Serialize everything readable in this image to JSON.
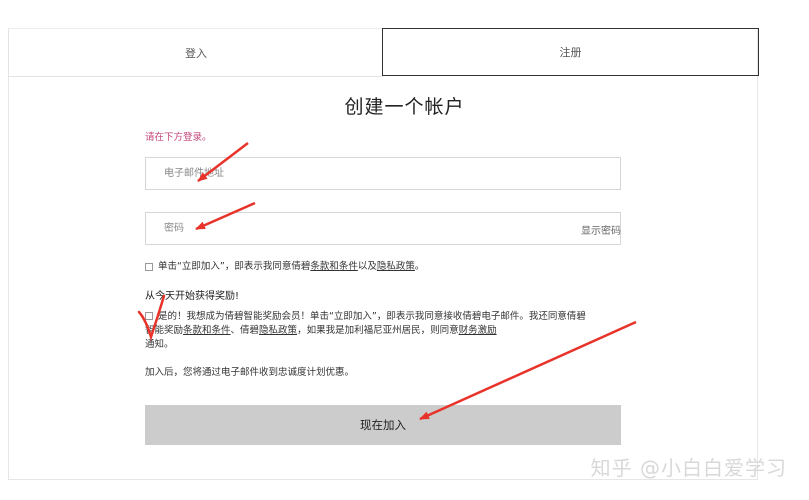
{
  "tabs": {
    "login": "登入",
    "register": "注册"
  },
  "form": {
    "title": "创建一个帐户",
    "hint": "请在下方登录。",
    "email_placeholder": "电子邮件地址",
    "password_placeholder": "密码",
    "show_password": "显示密码",
    "terms": {
      "prefix": "单击“立即加入”，即表示我同意倩碧",
      "terms_link": "条款和条件",
      "middle": "以及",
      "privacy_link": "隐私政策",
      "suffix": "。"
    },
    "rewards_heading": "从今天开始获得奖励!",
    "rewards": {
      "part1": "是的！我想成为倩碧智能奖励会员！单击“立即加入”，即表示我同意接收倩碧电子邮件。我还同意倩碧智能奖励",
      "terms_link": "条款和条件",
      "part2": "、倩碧",
      "privacy_link": "隐私政策",
      "part3": "，如果我是加利福尼亚州居民，则同意",
      "incentive_link": "财务激励",
      "part4": "通知。"
    },
    "note": "加入后，您将通过电子邮件收到忠诚度计划优惠。",
    "submit": "现在加入"
  },
  "watermark": "知乎 @小白白爱学习",
  "colors": {
    "hint": "#c2457a",
    "submit_bg": "#cccccc",
    "annotation": "#e8332a"
  }
}
